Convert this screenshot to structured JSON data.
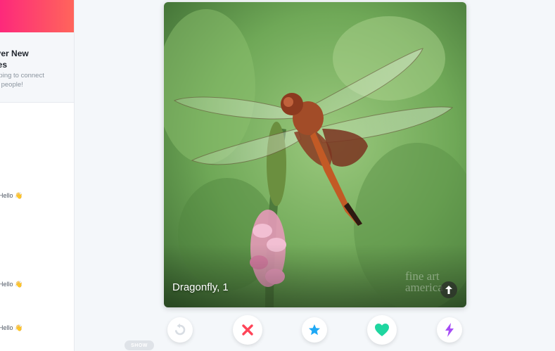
{
  "sidebar": {
    "discover": {
      "title": "Discover New\nMatches",
      "text": "Start swiping to connect\nwith new people!"
    },
    "messages": [
      {
        "text": "New match! Say Hello 👋"
      },
      {
        "text": "New match! Say Hello 👋"
      },
      {
        "text": "New match! Say Hello 👋"
      }
    ],
    "show_label": "SHOW"
  },
  "card": {
    "name_age": "Dragonfly, 1",
    "watermark": "fine art\namerica"
  },
  "actions": [
    {
      "name": "rewind",
      "icon": "rewind-icon",
      "color": "#d8dde3"
    },
    {
      "name": "nope",
      "icon": "close-icon",
      "color": "#ff4458"
    },
    {
      "name": "super-like",
      "icon": "star-icon",
      "color": "#1ea8f5"
    },
    {
      "name": "like",
      "icon": "heart-icon",
      "color": "#1fd6a0"
    },
    {
      "name": "boost",
      "icon": "lightning-icon",
      "color": "#a64cf5"
    }
  ],
  "colors": {
    "brand_gradient_start": "#fd297b",
    "brand_gradient_end": "#ff655b"
  }
}
